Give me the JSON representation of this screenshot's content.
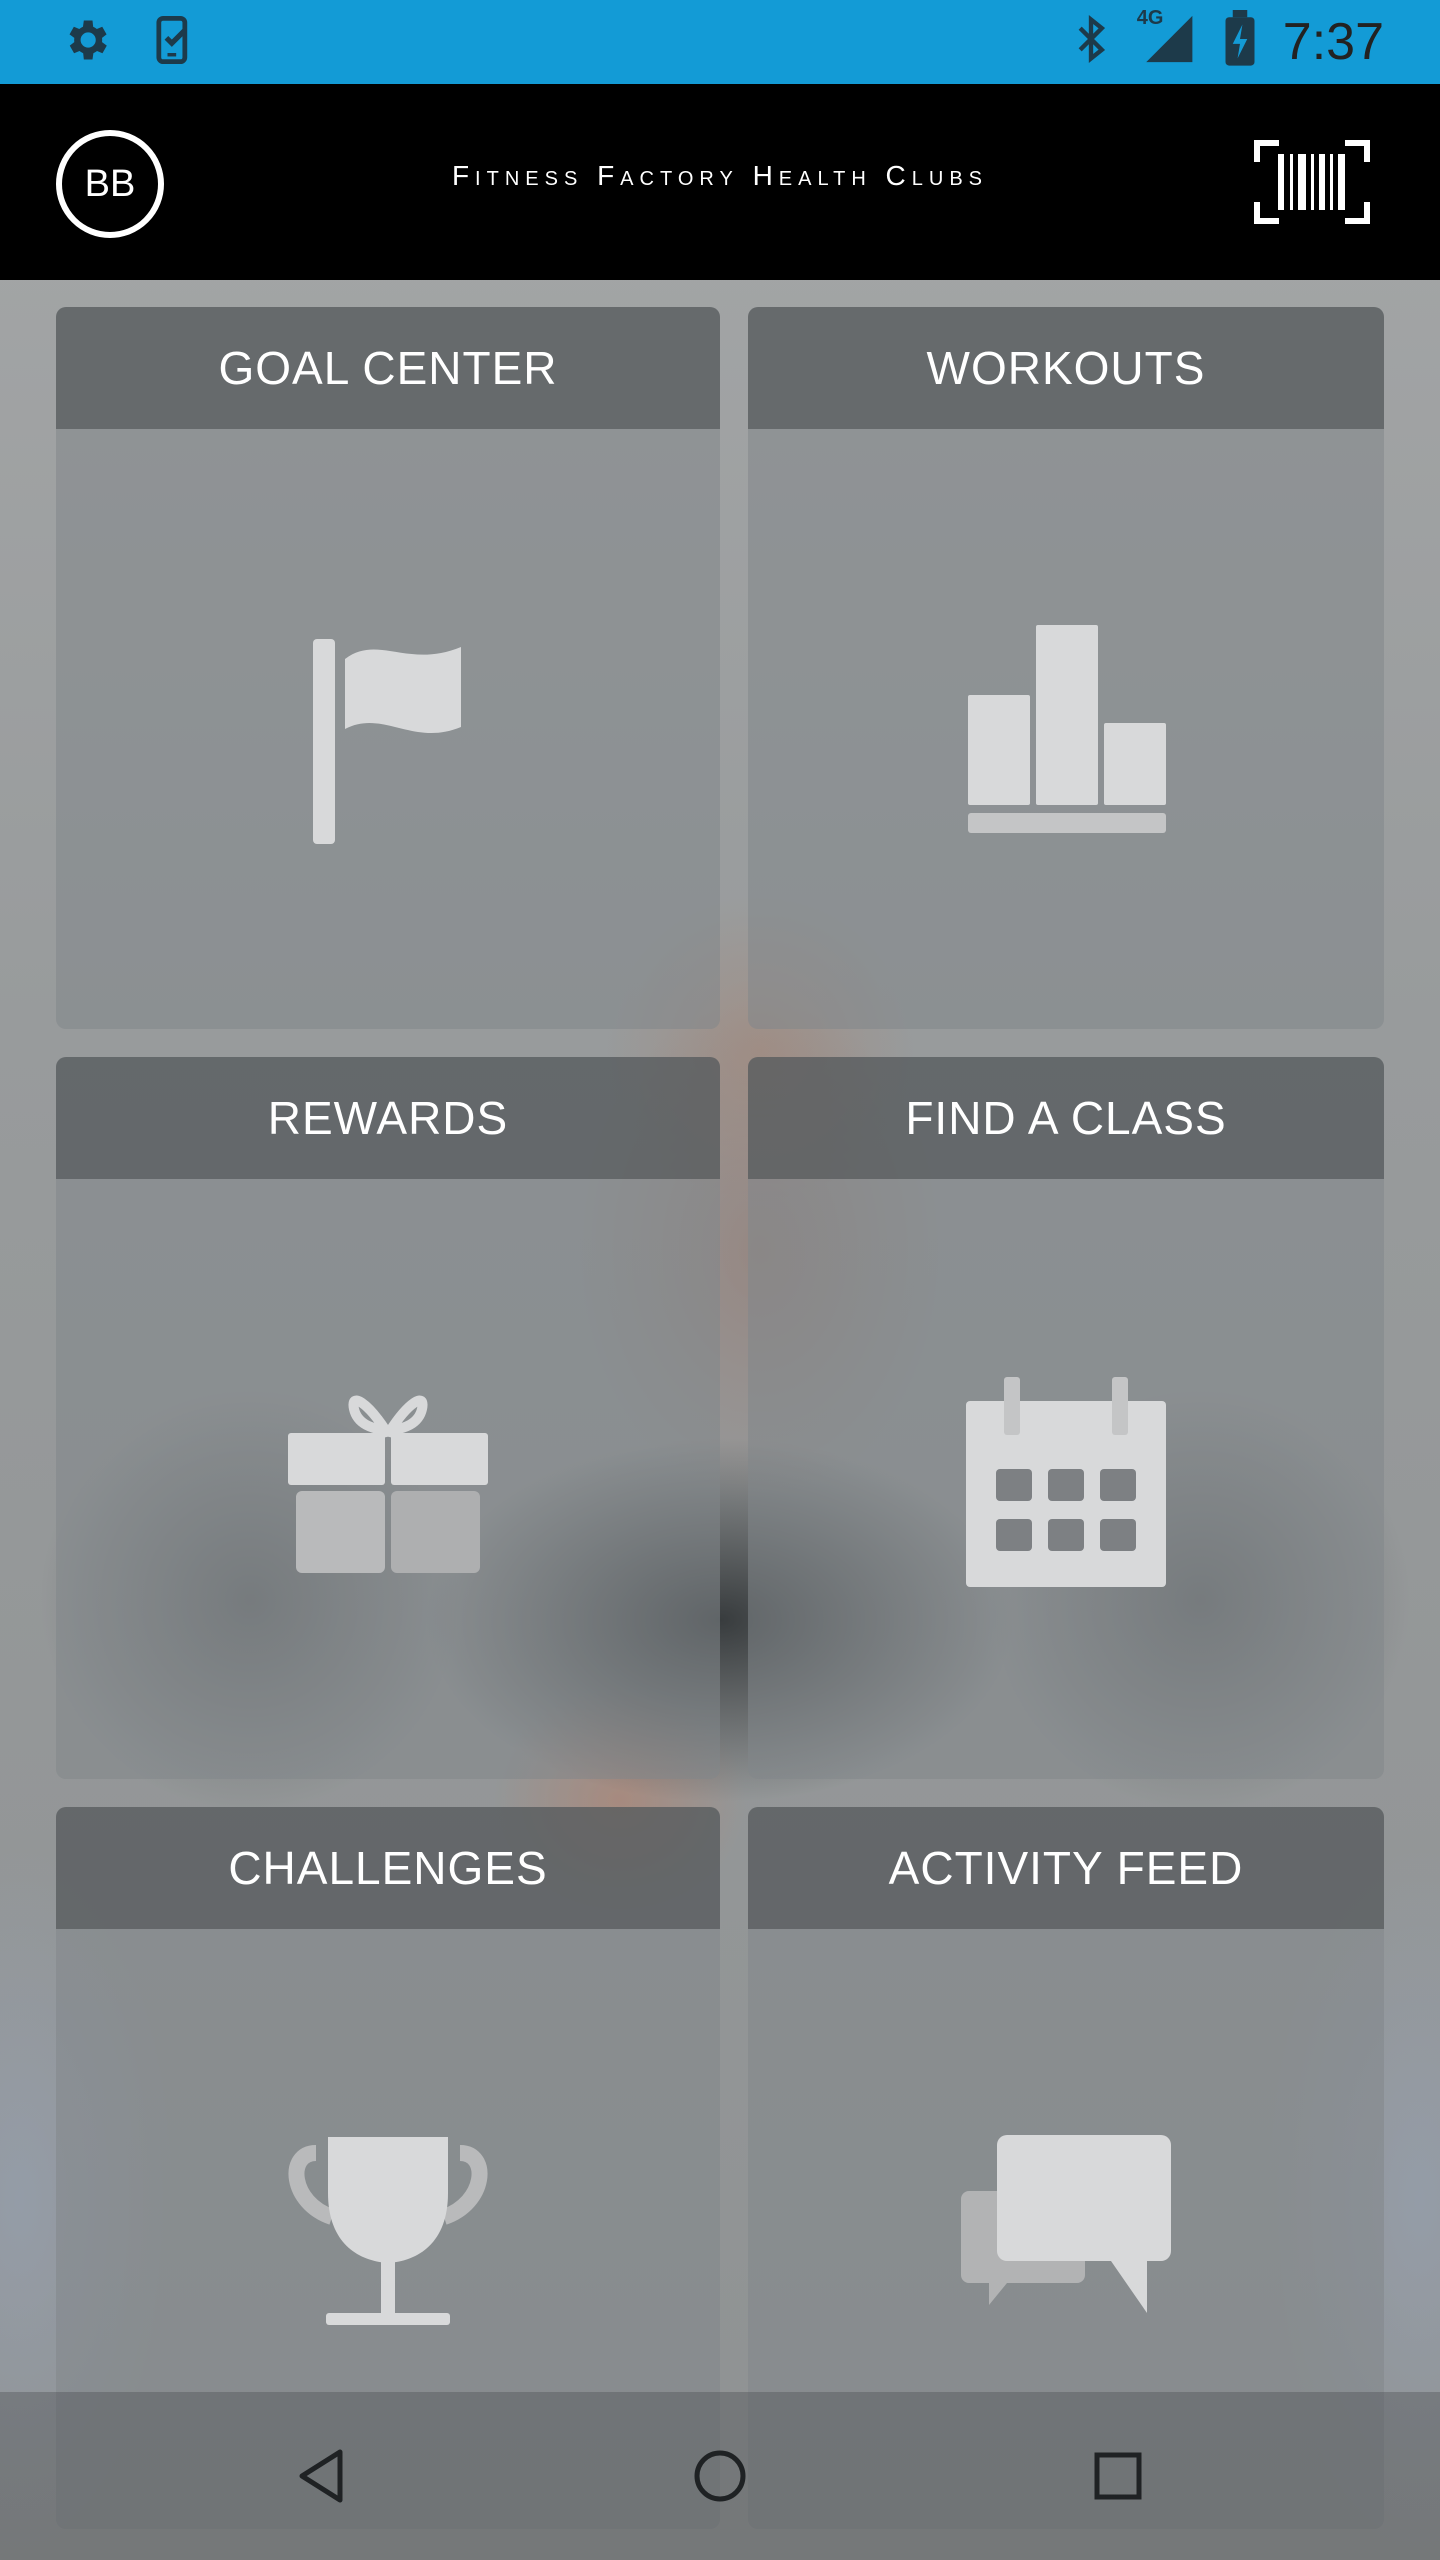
{
  "status_bar": {
    "time": "7:37",
    "network": "4G",
    "icons": [
      "settings-icon",
      "clipboard-check-icon",
      "bluetooth-icon",
      "signal-icon",
      "battery-icon"
    ]
  },
  "header": {
    "avatar_initials": "BB",
    "brand": "Fitness Factory Health Clubs",
    "barcode_icon": "barcode-scan-icon"
  },
  "tiles": [
    {
      "label": "GOAL CENTER",
      "icon": "flag-icon"
    },
    {
      "label": "WORKOUTS",
      "icon": "bar-chart-icon"
    },
    {
      "label": "REWARDS",
      "icon": "gift-icon"
    },
    {
      "label": "FIND A CLASS",
      "icon": "calendar-icon"
    },
    {
      "label": "CHALLENGES",
      "icon": "trophy-icon"
    },
    {
      "label": "ACTIVITY FEED",
      "icon": "chat-bubbles-icon"
    }
  ],
  "nav": {
    "icons": [
      "back-icon",
      "home-icon",
      "recents-icon"
    ]
  },
  "colors": {
    "status_bar": "#139bd6",
    "app_bar": "#000000",
    "icon_fill": "#d8d9da"
  }
}
